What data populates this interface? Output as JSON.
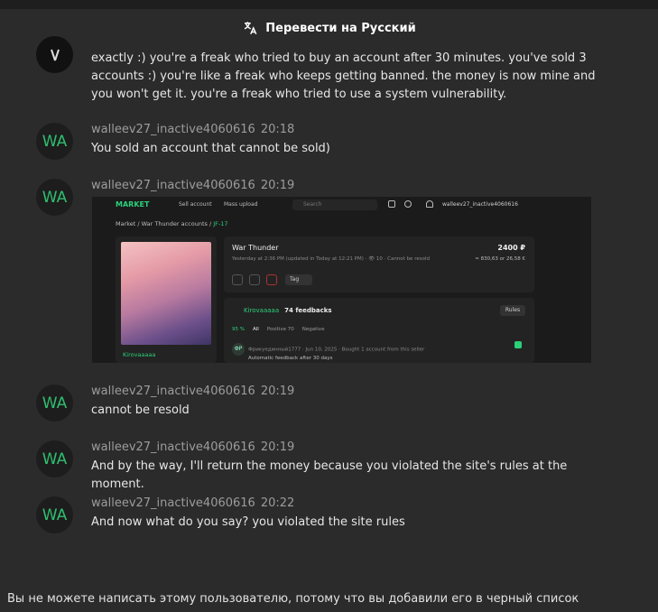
{
  "translate_bar": {
    "label": "Перевести на Русский",
    "icon": "translate-icon"
  },
  "messages": [
    {
      "avatar": "",
      "author": "",
      "time": "",
      "text": "exactly :) you're a freak who tried to buy an account after 30 minutes. you've sold 3 accounts :) you're like a freak who keeps getting banned. the money is now mine and you won't get it. you're a freak who tried to use a system vulnerability."
    },
    {
      "avatar": "WA",
      "author": "walleev27_inactive4060616",
      "time": "20:18",
      "text": "You sold an account that cannot be sold)"
    },
    {
      "avatar": "WA",
      "author": "walleev27_inactive4060616",
      "time": "20:19",
      "text": ""
    },
    {
      "avatar": "WA",
      "author": "walleev27_inactive4060616",
      "time": "20:19",
      "text": "cannot be resold"
    },
    {
      "avatar": "WA",
      "author": "walleev27_inactive4060616",
      "time": "20:19",
      "text": "And by the way, I'll return the money because you violated the site's rules at the moment."
    },
    {
      "avatar": "WA",
      "author": "walleev27_inactive4060616",
      "time": "20:22",
      "text": "And now what do you say? you violated the site rules"
    }
  ],
  "attachment": {
    "logo": "MARKET",
    "nav": [
      "Sell account",
      "Mass upload"
    ],
    "search_placeholder": "Search",
    "user": "walleev27_inactive4060616",
    "breadcrumb": {
      "root": "Market",
      "section": "War Thunder accounts",
      "id": "JF-17"
    },
    "seller_name": "Kirovaaaaa",
    "item_title": "War Thunder",
    "price": "2400 ₽",
    "price_alt": "≈ 830,63 or 26,58 €",
    "meta": "Yesterday at 2:36 PM (updated in Today at 12:21 PM) · 👁 10 · Cannot be resold",
    "tag_label": "Tag",
    "feedback_user": "Kirovaaaaa",
    "feedback_count": "74 feedbacks",
    "rules_label": "Rules",
    "tabs": [
      "95 %",
      "All",
      "Positive 70",
      "Negative"
    ],
    "review_avatar": "ФР",
    "review_meta": "Фрикуединный1777 · Jun 10, 2025 · Bought 1 account from this seller",
    "review_text": "Automatic feedback after 30 days"
  },
  "footer": {
    "text": "Вы не можете написать этому пользователю, потому что вы добавили его в черный список"
  },
  "colors": {
    "background": "#2b2b2b",
    "accent": "#2fbf6f",
    "avatar_bg": "#1d1d1d"
  }
}
